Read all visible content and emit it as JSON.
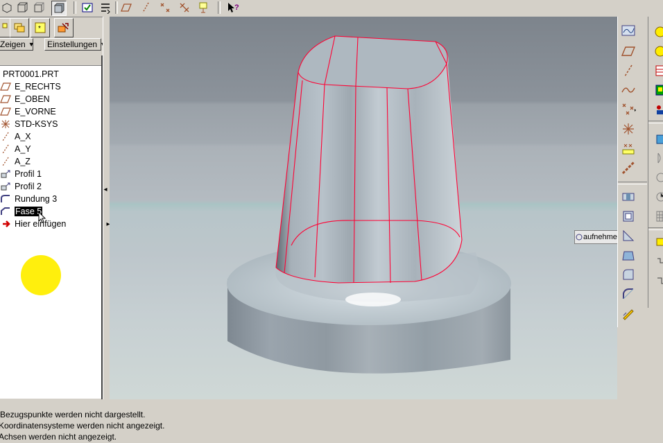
{
  "toolbar": {
    "buttons": [
      "view-iso-icon",
      "view-wire-icon",
      "view-hidden-icon",
      "view-shaded-icon",
      "regenerate-check-icon",
      "datum-axis-display-icon",
      "datum-plane-display-icon",
      "datum-axis-icon",
      "datum-point-icon",
      "csys-display-icon",
      "csys-toggle-icon",
      "whats-this-icon"
    ]
  },
  "left_panel": {
    "tabs": [
      "model-tree-tab",
      "folder-tab",
      "favorites-tab",
      "connections-tab"
    ],
    "menu": {
      "show_label": "Zeigen",
      "settings_label": "Einstellungen"
    },
    "tree": {
      "root": "PRT0001.PRT",
      "items": [
        {
          "label": "E_RECHTS",
          "icon": "datum-plane-icon"
        },
        {
          "label": "E_OBEN",
          "icon": "datum-plane-icon"
        },
        {
          "label": "E_VORNE",
          "icon": "datum-plane-icon"
        },
        {
          "label": "STD-KSYS",
          "icon": "csys-icon"
        },
        {
          "label": "A_X",
          "icon": "datum-axis-icon"
        },
        {
          "label": "A_Y",
          "icon": "datum-axis-icon"
        },
        {
          "label": "A_Z",
          "icon": "datum-axis-icon"
        },
        {
          "label": "Profil 1",
          "icon": "extrude-icon"
        },
        {
          "label": "Profil 2",
          "icon": "extrude-icon"
        },
        {
          "label": "Rundung 3",
          "icon": "round-icon"
        },
        {
          "label": "Fase 5",
          "icon": "chamfer-icon",
          "selected": true
        },
        {
          "label": "Hier einfügen",
          "icon": "insert-here-arrow-icon"
        }
      ]
    }
  },
  "viewport": {
    "tooltip_text": "aufnehme"
  },
  "status": {
    "lines": [
      "Bezugspunkte werden nicht dargestellt.",
      "Koordinatensysteme werden nicht angezeigt.",
      "Achsen werden nicht angezeigt."
    ]
  },
  "colors": {
    "edge_highlight": "#ff0033",
    "cursor_highlight": "#ffee00",
    "model_body": "#a9b4bb"
  }
}
